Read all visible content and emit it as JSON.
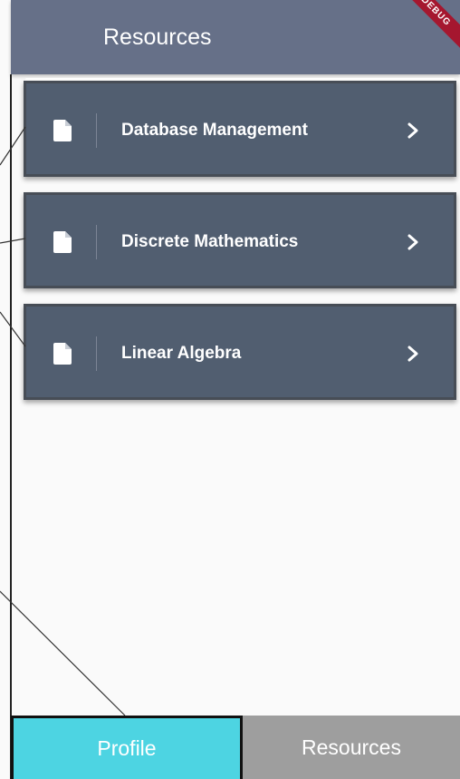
{
  "app_bar": {
    "title": "Resources",
    "debug_banner": "DEBUG"
  },
  "resources": [
    {
      "label": "Database Management",
      "icon": "document-icon"
    },
    {
      "label": "Discrete Mathematics",
      "icon": "document-icon"
    },
    {
      "label": "Linear Algebra",
      "icon": "document-icon"
    }
  ],
  "bottom_nav": {
    "tabs": [
      {
        "label": "Profile",
        "active": true
      },
      {
        "label": "Resources",
        "active": false
      }
    ]
  },
  "colors": {
    "app_bar": "#667088",
    "card": "#515e70",
    "profile_tab": "#4dd4e2",
    "resources_tab": "#9e9e9e",
    "debug_banner": "#a5172f"
  }
}
